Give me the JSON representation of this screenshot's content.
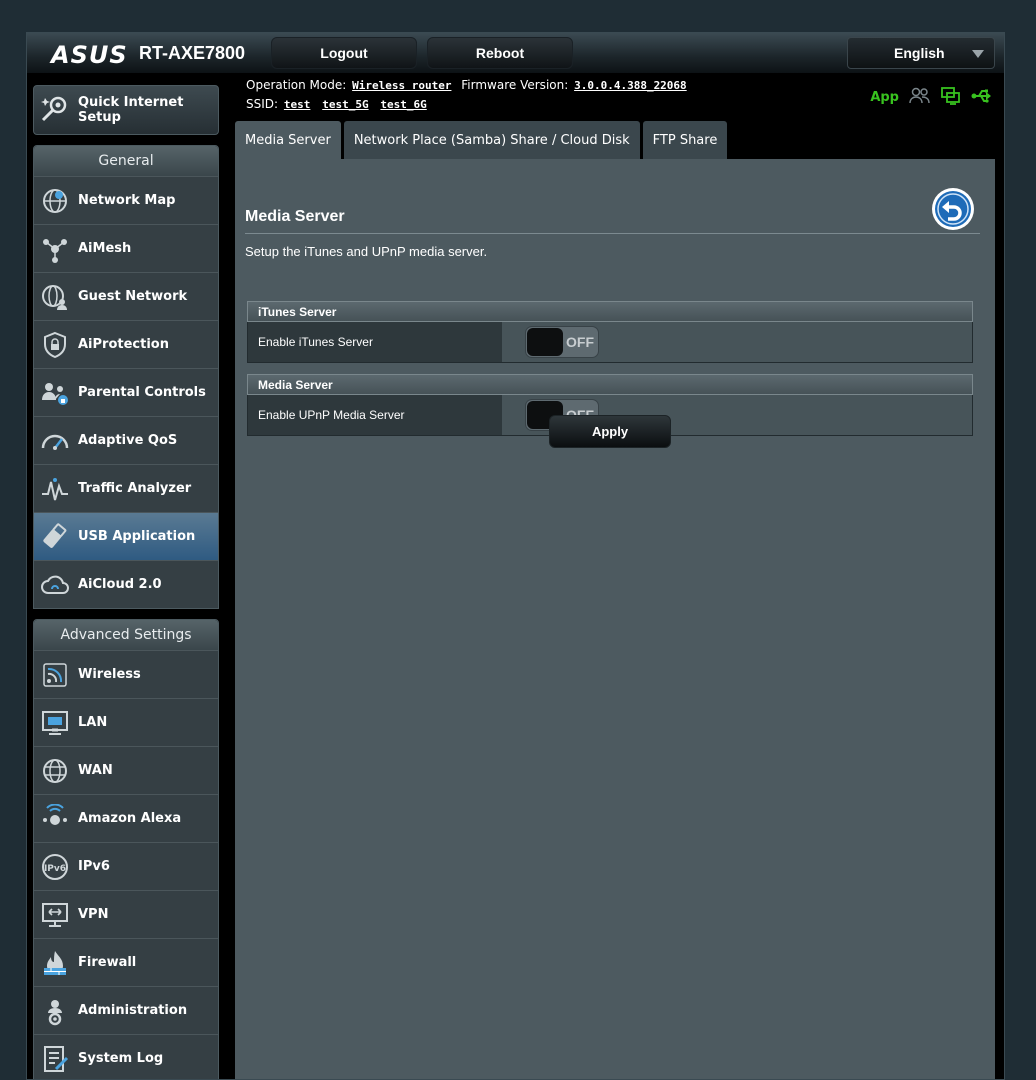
{
  "header": {
    "brand": "ASUS",
    "model": "RT-AXE7800",
    "logout_label": "Logout",
    "reboot_label": "Reboot",
    "language": "English"
  },
  "info": {
    "op_mode_label": "Operation Mode:",
    "op_mode_value": "Wireless router",
    "firmware_label": "Firmware Version:",
    "firmware_value": "3.0.0.4.388_22068",
    "ssid_label": "SSID:",
    "ssid_values": [
      "test",
      "test_5G",
      "test_6G"
    ],
    "app_label": "App"
  },
  "sidebar": {
    "quick_setup": "Quick Internet Setup",
    "general_header": "General",
    "general_items": [
      {
        "label": "Network Map",
        "icon": "network-map-icon"
      },
      {
        "label": "AiMesh",
        "icon": "aimesh-icon"
      },
      {
        "label": "Guest Network",
        "icon": "guest-network-icon"
      },
      {
        "label": "AiProtection",
        "icon": "shield-lock-icon"
      },
      {
        "label": "Parental Controls",
        "icon": "parental-controls-icon"
      },
      {
        "label": "Adaptive QoS",
        "icon": "speedometer-icon"
      },
      {
        "label": "Traffic Analyzer",
        "icon": "traffic-analyzer-icon"
      },
      {
        "label": "USB Application",
        "icon": "usb-icon",
        "active": true
      },
      {
        "label": "AiCloud 2.0",
        "icon": "cloud-icon"
      }
    ],
    "advanced_header": "Advanced Settings",
    "advanced_items": [
      {
        "label": "Wireless",
        "icon": "wireless-icon"
      },
      {
        "label": "LAN",
        "icon": "lan-icon"
      },
      {
        "label": "WAN",
        "icon": "globe-icon"
      },
      {
        "label": "Amazon Alexa",
        "icon": "alexa-icon"
      },
      {
        "label": "IPv6",
        "icon": "ipv6-icon"
      },
      {
        "label": "VPN",
        "icon": "vpn-icon"
      },
      {
        "label": "Firewall",
        "icon": "firewall-icon"
      },
      {
        "label": "Administration",
        "icon": "gear-person-icon"
      },
      {
        "label": "System Log",
        "icon": "system-log-icon"
      }
    ]
  },
  "tabs": [
    "Media Server",
    "Network Place (Samba) Share / Cloud Disk",
    "FTP Share"
  ],
  "main": {
    "title": "Media Server",
    "description": "Setup the iTunes and UPnP media server.",
    "sections": [
      {
        "header": "iTunes Server",
        "row_label": "Enable iTunes Server",
        "state": "OFF"
      },
      {
        "header": "Media Server",
        "row_label": "Enable UPnP Media Server",
        "state": "OFF"
      }
    ],
    "apply_label": "Apply"
  }
}
